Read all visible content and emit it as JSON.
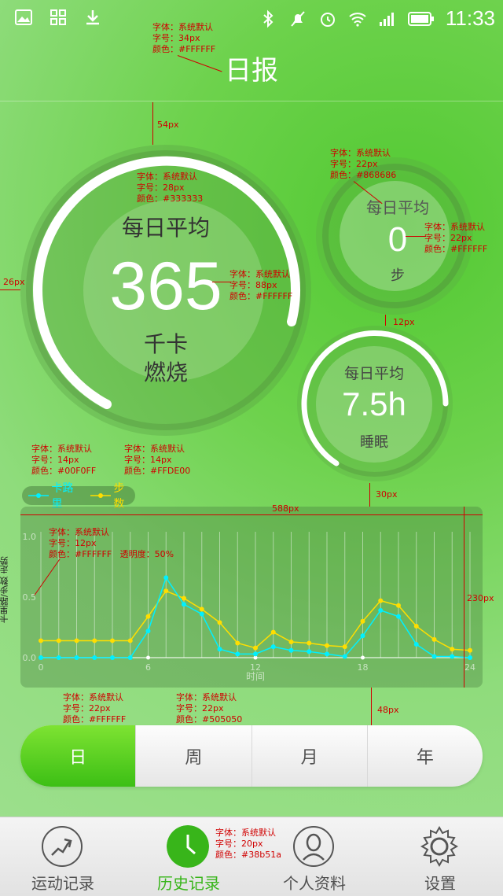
{
  "status_bar": {
    "time": "11:33"
  },
  "header": {
    "title": "日报"
  },
  "calorie_ring": {
    "caption": "每日平均",
    "value": "365",
    "unit_line1": "千卡",
    "unit_line2": "燃烧"
  },
  "steps_ring": {
    "caption": "每日平均",
    "value": "0",
    "unit": "步"
  },
  "sleep_ring": {
    "caption": "每日平均",
    "value": "7.5h",
    "unit": "睡眠"
  },
  "legend": {
    "calories": "卡路里",
    "steps": "步数",
    "calories_color": "#00F0FF",
    "steps_color": "#FFDE00"
  },
  "chart_data": {
    "type": "line",
    "xlabel": "时间",
    "ylabel": "卡里路/步数 走势",
    "x_ticks": [
      "0",
      "6",
      "12",
      "18",
      "24"
    ],
    "y_ticks": [
      "1.0",
      "0.5",
      "0.0"
    ],
    "xlim": [
      0,
      24
    ],
    "ylim": [
      0,
      1.0
    ],
    "x": [
      0,
      1,
      2,
      3,
      4,
      5,
      6,
      7,
      8,
      9,
      10,
      11,
      12,
      13,
      14,
      15,
      16,
      17,
      18,
      19,
      20,
      21,
      22,
      23,
      24
    ],
    "series": [
      {
        "name": "卡路里",
        "color": "#00F0FF",
        "values": [
          0,
          0,
          0,
          0,
          0,
          0,
          0.22,
          0.66,
          0.44,
          0.36,
          0.07,
          0.03,
          0.03,
          0.09,
          0.06,
          0.05,
          0.03,
          0.01,
          0.18,
          0.39,
          0.34,
          0.11,
          0.01,
          0.01,
          0
        ]
      },
      {
        "name": "步数",
        "color": "#FFDE00",
        "values": [
          0.14,
          0.14,
          0.14,
          0.14,
          0.14,
          0.14,
          0.34,
          0.55,
          0.49,
          0.4,
          0.29,
          0.12,
          0.08,
          0.21,
          0.13,
          0.12,
          0.1,
          0.09,
          0.3,
          0.47,
          0.43,
          0.26,
          0.15,
          0.07,
          0.06
        ]
      }
    ]
  },
  "period_tabs": [
    "日",
    "周",
    "月",
    "年"
  ],
  "bottom_nav": [
    {
      "label": "运动记录"
    },
    {
      "label": "历史记录"
    },
    {
      "label": "个人资料"
    },
    {
      "label": "设置"
    }
  ],
  "annotations": {
    "title_spec": "字体：系统默认\n字号：34px\n颜色：#FFFFFF",
    "caption_spec": "字体：系统默认\n字号：28px\n颜色：#333333",
    "value_spec": "字体：系统默认\n字号：88px\n颜色：#FFFFFF",
    "small_caption_spec": "字体：系统默认\n字号：22px\n颜色：#868686",
    "small_value_spec": "字体：系统默认\n字号：22px\n颜色：#FFFFFF",
    "legend_cal_spec": "字体：系统默认\n字号：14px\n颜色：#00F0FF",
    "legend_step_spec": "字体：系统默认\n字号：14px\n颜色：#FFDE00",
    "axis_spec": "字体：系统默认\n字号：12px\n颜色：#FFFFFF   透明度：50%",
    "tab_active_spec": "字体：系统默认\n字号：22px\n颜色：#FFFFFF",
    "tab_spec": "字体：系统默认\n字号：22px\n颜色：#505050",
    "nav_spec": "字体：系统默认\n字号：20px\n颜色：#38b51a",
    "dim_54": "54px",
    "dim_26": "26px",
    "dim_12": "12px",
    "dim_30": "30px",
    "dim_588": "588px",
    "dim_230": "230px",
    "dim_48": "48px"
  }
}
